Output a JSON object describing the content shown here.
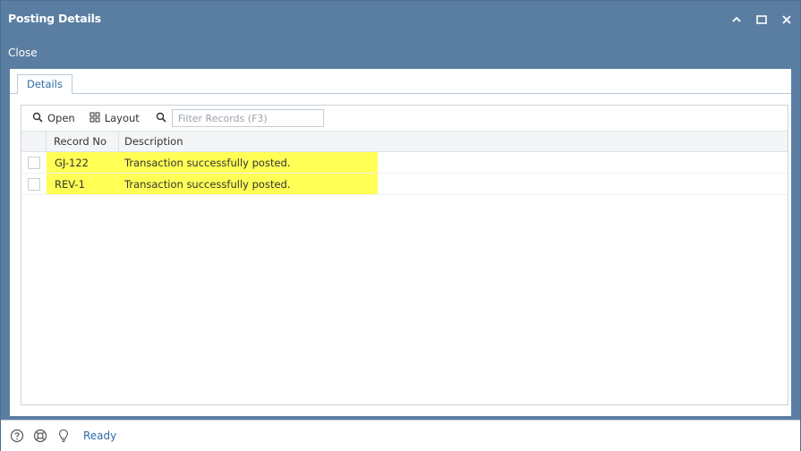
{
  "window": {
    "title": "Posting Details",
    "controls": [
      "chevron-up-icon",
      "maximize-icon",
      "close-icon"
    ]
  },
  "toolbar": {
    "close_label": "Close"
  },
  "tabs": [
    {
      "label": "Details",
      "active": true
    }
  ],
  "grid_toolbar": {
    "open_label": "Open",
    "layout_label": "Layout",
    "filter_placeholder": "Filter Records (F3)"
  },
  "grid": {
    "columns": [
      "Record No",
      "Description"
    ],
    "rows": [
      {
        "record_no": "GJ-122",
        "description": "Transaction successfully posted.",
        "highlight": "#ffff55"
      },
      {
        "record_no": "REV-1",
        "description": "Transaction successfully posted.",
        "highlight": "#ffff55"
      }
    ]
  },
  "statusbar": {
    "icons": [
      "help-icon",
      "support-icon",
      "lightbulb-icon"
    ],
    "status": "Ready"
  },
  "colors": {
    "titlebar": "#5a7ea1",
    "accent_text": "#2e6aa6",
    "highlight": "#ffff55"
  }
}
